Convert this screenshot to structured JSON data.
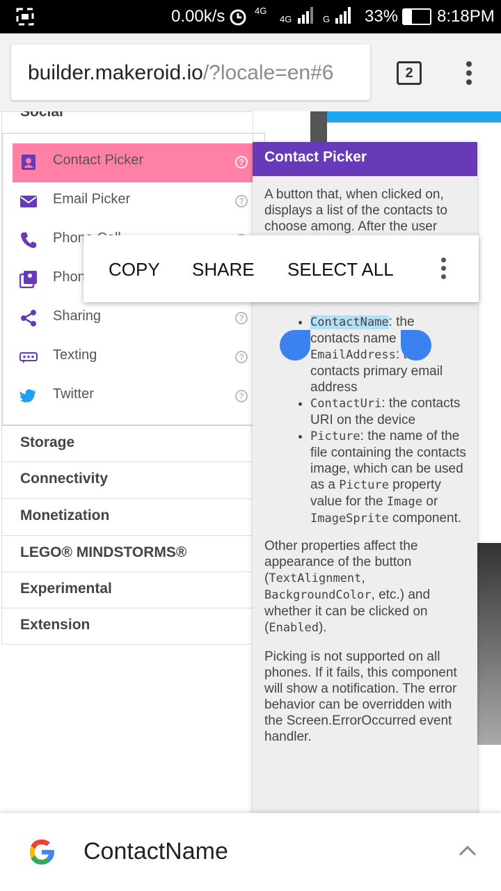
{
  "status_bar": {
    "speed": "0.00k/s",
    "network_a": "4G",
    "network_b": "4G",
    "network_c": "G",
    "battery": "33%",
    "time": "8:18PM"
  },
  "browser": {
    "url_host": "builder.makeroid.io",
    "url_rest": "/?locale=en#6",
    "tab_count": "2"
  },
  "palette": {
    "section_partial": "Social",
    "items": [
      {
        "label": "Contact Picker",
        "icon": "contact-icon",
        "selected": true
      },
      {
        "label": "Email Picker",
        "icon": "email-icon"
      },
      {
        "label": "Phone Call",
        "icon": "phone-icon"
      },
      {
        "label": "Phon",
        "icon": "photo-icon"
      },
      {
        "label": "Sharing",
        "icon": "share-icon"
      },
      {
        "label": "Texting",
        "icon": "texting-icon"
      },
      {
        "label": "Twitter",
        "icon": "twitter-icon"
      }
    ],
    "help_glyph": "?",
    "categories": [
      "Storage",
      "Connectivity",
      "Monetization",
      "LEGO® MINDSTORMS®",
      "Experimental",
      "Extension"
    ]
  },
  "popup": {
    "title": "Contact Picker",
    "intro": "A button that, when clicked on, displays a list of the contacts to choose among. After the user",
    "bullets": [
      {
        "code": "ContactName",
        "text": ": the contacts name"
      },
      {
        "code": "EmailAddress",
        "text": ": the contacts primary email address"
      },
      {
        "code": "ContactUri",
        "text": ": the contacts URI on the device"
      },
      {
        "code": "Picture",
        "text": ": the name of the file containing the contacts image, which can be used as a ",
        "code2": "Picture",
        "text2": " property value for the ",
        "code3": "Image",
        "text3": " or ",
        "code4": "ImageSprite",
        "text4": " component."
      }
    ],
    "para2_a": "Other properties affect the appearance of the button (",
    "para2_code1": "TextAlignment",
    "para2_b": ", ",
    "para2_code2": "BackgroundColor",
    "para2_c": ", etc.) and whether it can be clicked on (",
    "para2_code3": "Enabled",
    "para2_d": ").",
    "para3": "Picking is not supported on all phones. If it fails, this component will show a notification. The error behavior can be overridden with the Screen.ErrorOccurred event handler."
  },
  "context_menu": {
    "copy": "COPY",
    "share": "SHARE",
    "select_all": "SELECT ALL"
  },
  "search_bar": {
    "query": "ContactName"
  },
  "colors": {
    "selected_item": "#ff80a6",
    "popup_header": "#673ab7",
    "icon_purple": "#673ab7",
    "selection_handle": "#3b82f0",
    "twitter_blue": "#1da1f2"
  }
}
